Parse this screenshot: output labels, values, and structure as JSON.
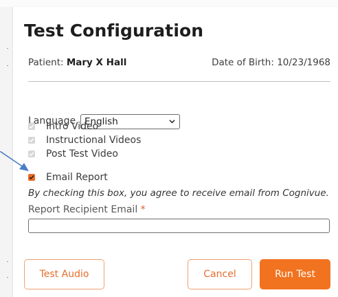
{
  "modal": {
    "title": "Test Configuration"
  },
  "patient": {
    "label": "Patient:",
    "name": "Mary X Hall",
    "dob_label": "Date of Birth:",
    "dob": "10/23/1968"
  },
  "language": {
    "label": "Language",
    "selected": "English"
  },
  "options": [
    {
      "label": "Intro Video",
      "checked": true,
      "disabled": true
    },
    {
      "label": "Instructional Videos",
      "checked": true,
      "disabled": true
    },
    {
      "label": "Post Test Video",
      "checked": true,
      "disabled": true
    },
    {
      "label": "Email Report",
      "checked": true,
      "disabled": false
    }
  ],
  "email": {
    "disclaimer": "By checking this box, you agree to receive email from Cognivue.",
    "field_label": "Report Recipient Email",
    "required_mark": "*",
    "value": ""
  },
  "buttons": {
    "test_audio": "Test Audio",
    "cancel": "Cancel",
    "run_test": "Run Test"
  },
  "colors": {
    "accent": "#f2731f",
    "accent_outline": "#f0a070",
    "annotation_arrow": "#4a7fc6"
  }
}
